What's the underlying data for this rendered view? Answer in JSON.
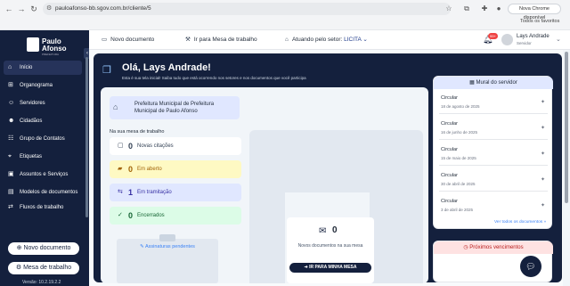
{
  "browser": {
    "url": "pauloafonso-bb.sgov.com.br/cliente/5",
    "notice": "Nova Chrome disponível",
    "bookmarks": "Todos os favoritos"
  },
  "sidebar": {
    "logo_name_line1": "Paulo",
    "logo_name_line2": "Afonso",
    "logo_sub": "PREFEITURA",
    "items": [
      {
        "label": "Início",
        "icon": "home-icon"
      },
      {
        "label": "Organograma",
        "icon": "sitemap-icon"
      },
      {
        "label": "Servidores",
        "icon": "users-icon"
      },
      {
        "label": "Cidadãos",
        "icon": "person-icon"
      },
      {
        "label": "Grupo de Contatos",
        "icon": "contacts-icon"
      },
      {
        "label": "Etiquetas",
        "icon": "tag-icon"
      },
      {
        "label": "Assuntos e Serviços",
        "icon": "briefcase-icon"
      },
      {
        "label": "Modelos de documentos",
        "icon": "document-icon"
      },
      {
        "label": "Fluxos de trabalho",
        "icon": "flow-icon"
      }
    ],
    "new_doc_button": "Novo documento",
    "desk_button": "Mesa de trabalho",
    "version": "Versão: 10.2.19.2.2"
  },
  "topbar": {
    "new_doc": "Novo documento",
    "go_desk": "Ir para Mesa de trabalho",
    "sector_label": "Atuando pelo setor:",
    "sector_value": "LICITA",
    "notif_count": "99+",
    "user_name": "Lays Andrade",
    "user_role": "Servidor"
  },
  "hero": {
    "title": "Olá, Lays Andrade!",
    "subtitle": "Esta é sua tela inicial! Saiba tudo que está ocorrendo nos setores e nos documentos que você participa"
  },
  "org": {
    "name": "Prefeitura Municipal de Prefeitura Municipal de Paulo Afonso"
  },
  "desk": {
    "label": "Na sua mesa de trabalho",
    "stats": [
      {
        "num": "0",
        "label": "Novas citações"
      },
      {
        "num": "0",
        "label": "Em aberto"
      },
      {
        "num": "1",
        "label": "Em tramitação"
      },
      {
        "num": "0",
        "label": "Encerrados"
      }
    ],
    "signatures": "Assinaturas pendentes"
  },
  "empty": {
    "count": "0",
    "text": "Novos documentos na sua mesa",
    "button": "IR PARA MINHA MESA"
  },
  "mural": {
    "title": "Mural do servidor",
    "items": [
      {
        "title": "Circular",
        "date": "18 de agosto de 2025"
      },
      {
        "title": "Circular",
        "date": "16 de junho de 2025"
      },
      {
        "title": "Circular",
        "date": "15 de maio de 2025"
      },
      {
        "title": "Circular",
        "date": "30 de abril de 2025"
      },
      {
        "title": "Circular",
        "date": "3 de abril de 2025"
      }
    ],
    "link": "Ver todos os documentos"
  },
  "due": {
    "title": "Próximos vencimentos"
  }
}
